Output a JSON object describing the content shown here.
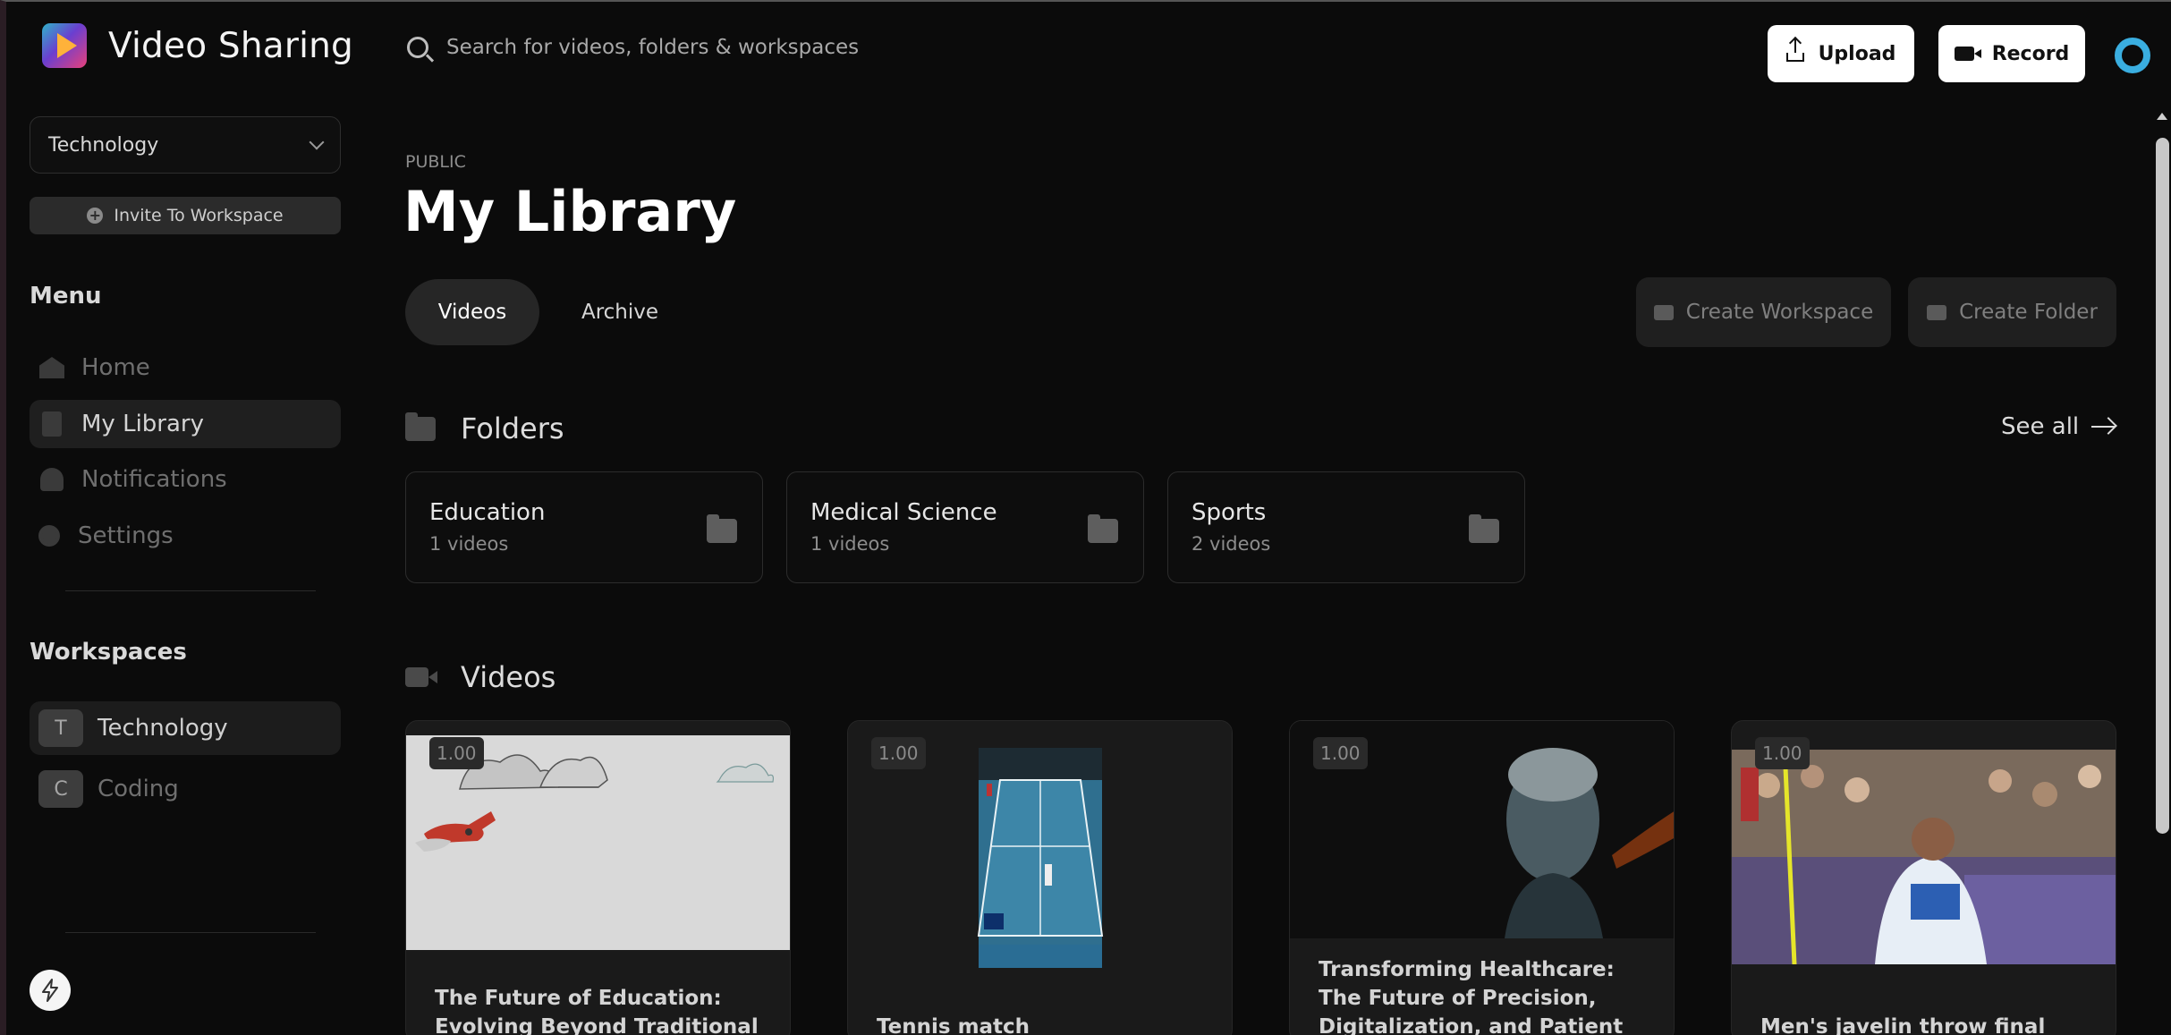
{
  "app": {
    "name": "Video Sharing"
  },
  "sidebar": {
    "workspace_selected": "Technology",
    "invite_label": "Invite To Workspace",
    "menu_title": "Menu",
    "menu_items": [
      {
        "label": "Home",
        "icon": "home-icon"
      },
      {
        "label": "My Library",
        "icon": "document-icon",
        "active": true
      },
      {
        "label": "Notifications",
        "icon": "bell-icon"
      },
      {
        "label": "Settings",
        "icon": "gear-icon"
      }
    ],
    "workspaces_title": "Workspaces",
    "workspaces": [
      {
        "initial": "T",
        "label": "Technology",
        "active": true
      },
      {
        "initial": "C",
        "label": "Coding"
      }
    ]
  },
  "header": {
    "search_placeholder": "Search for videos, folders & workspaces",
    "upload_label": "Upload",
    "record_label": "Record"
  },
  "main": {
    "visibility": "PUBLIC",
    "title": "My Library",
    "tabs": [
      {
        "label": "Videos",
        "active": true
      },
      {
        "label": "Archive"
      }
    ],
    "create_workspace_label": "Create Workspace",
    "create_folder_label": "Create Folder",
    "folders_title": "Folders",
    "see_all_label": "See all",
    "folders": [
      {
        "name": "Education",
        "count": "1 videos"
      },
      {
        "name": "Medical Science",
        "count": "1 videos"
      },
      {
        "name": "Sports",
        "count": "2 videos"
      }
    ],
    "videos_title": "Videos",
    "videos": [
      {
        "rating": "1.00",
        "title": "The Future of Education: Evolving Beyond Traditional Models"
      },
      {
        "rating": "1.00",
        "title": "Tennis match"
      },
      {
        "rating": "1.00",
        "title": "Transforming Healthcare: The Future of Precision, Digitalization, and Patient Empowerment"
      },
      {
        "rating": "1.00",
        "title": "Men's javelin throw final"
      }
    ]
  },
  "colors": {
    "accent": "#3aaee0",
    "background": "#0b0b0b"
  }
}
